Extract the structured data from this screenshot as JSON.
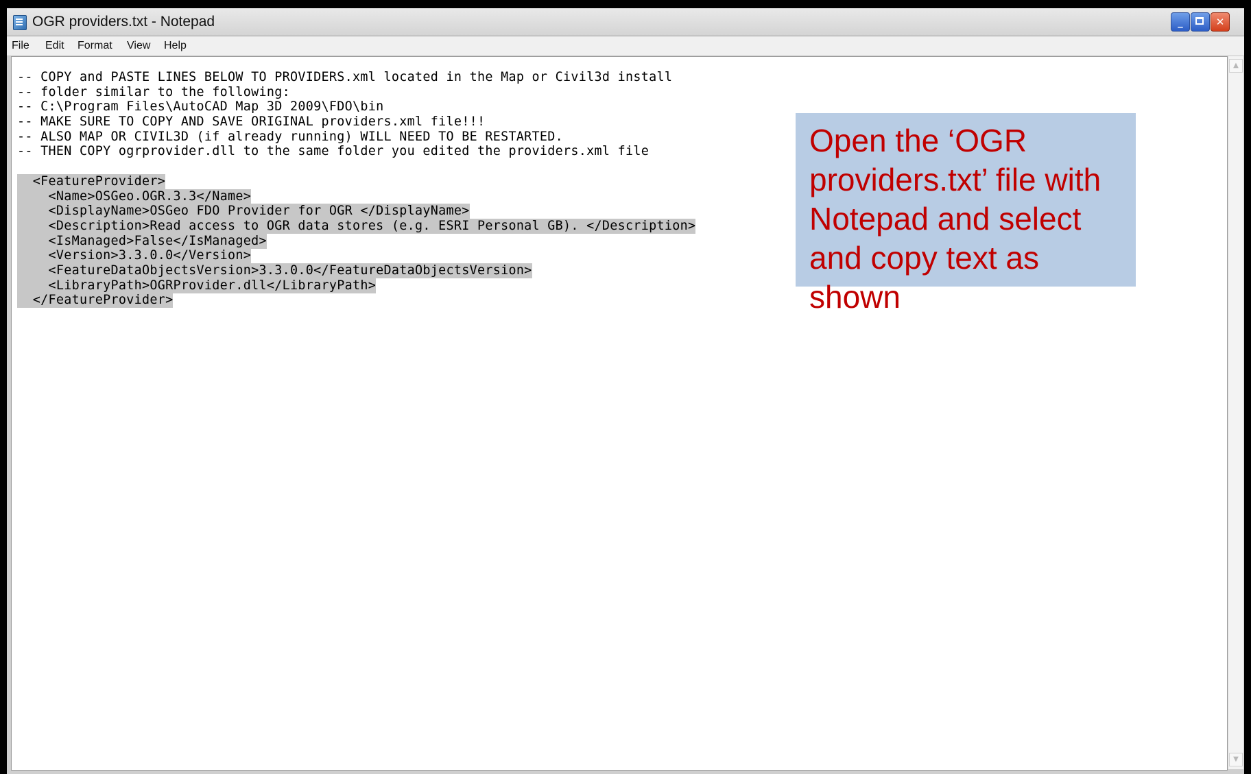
{
  "window": {
    "title": "OGR providers.txt - Notepad",
    "controls": {
      "minimize": "_",
      "close": "✕"
    }
  },
  "menu": [
    "File",
    "Edit",
    "Format",
    "View",
    "Help"
  ],
  "editor": {
    "lines": [
      "-- COPY and PASTE LINES BELOW TO PROVIDERS.xml located in the Map or Civil3d install",
      "-- folder similar to the following:",
      "-- C:\\Program Files\\AutoCAD Map 3D 2009\\FDO\\bin",
      "-- MAKE SURE TO COPY AND SAVE ORIGINAL providers.xml file!!!",
      "-- ALSO MAP OR CIVIL3D (if already running) WILL NEED TO BE RESTARTED.",
      "-- THEN COPY ogrprovider.dll to the same folder you edited the providers.xml file"
    ],
    "selected_lines": [
      "  <FeatureProvider>",
      "    <Name>OSGeo.OGR.3.3</Name>",
      "    <DisplayName>OSGeo FDO Provider for OGR </DisplayName>",
      "    <Description>Read access to OGR data stores (e.g. ESRI Personal GB). </Description>",
      "    <IsManaged>False</IsManaged>",
      "    <Version>3.3.0.0</Version>",
      "    <FeatureDataObjectsVersion>3.3.0.0</FeatureDataObjectsVersion>",
      "    <LibraryPath>OGRProvider.dll</LibraryPath>",
      "  </FeatureProvider>"
    ]
  },
  "scrollbar": {
    "up": "▲",
    "down": "▼"
  },
  "callout": {
    "text": "Open the ‘OGR\nproviders.txt’ file with\nNotepad and select\nand copy text as shown",
    "background": "#b8cce4",
    "color": "#c00000"
  }
}
